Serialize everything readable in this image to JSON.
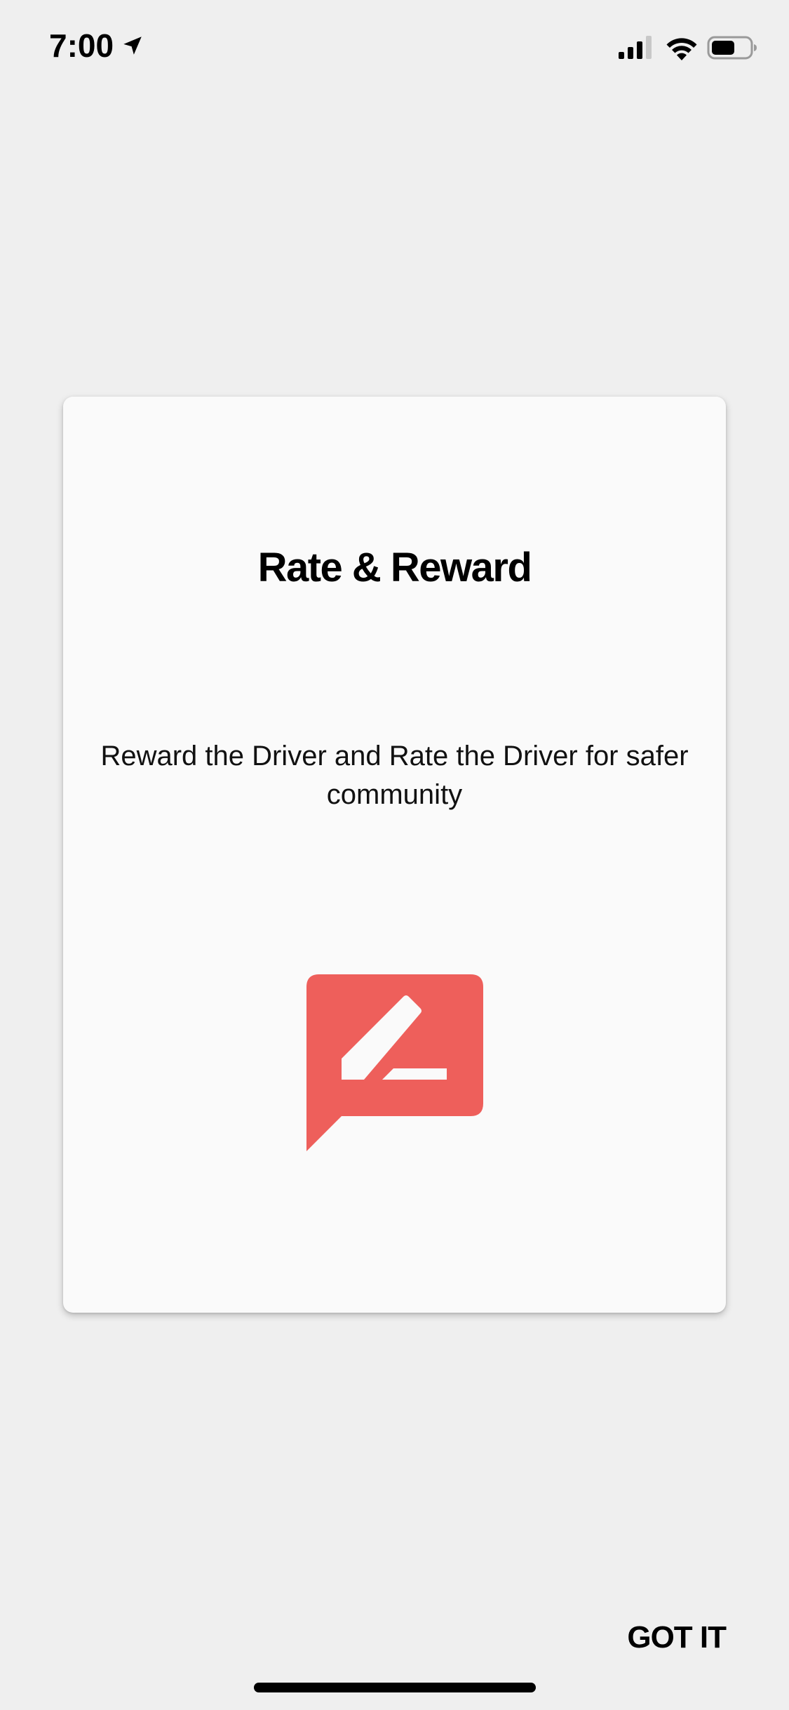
{
  "status_bar": {
    "time": "7:00",
    "icons": [
      "location-arrow-icon",
      "cellular-signal-icon",
      "wifi-icon",
      "battery-icon"
    ]
  },
  "card": {
    "title": "Rate & Reward",
    "description": "Reward the Driver and Rate the Driver for safer community",
    "icon": "rate-review-icon",
    "icon_color": "#ee5f5b"
  },
  "actions": {
    "got_it_label": "GOT IT"
  },
  "colors": {
    "background": "#efefef",
    "card_background": "#fafafa",
    "accent": "#ee5f5b"
  }
}
